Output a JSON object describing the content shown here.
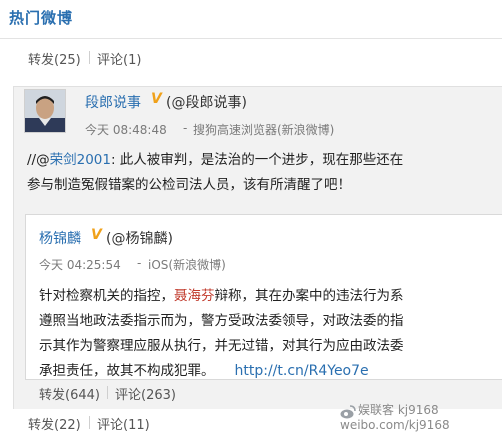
{
  "section": {
    "title": "热门微博"
  },
  "top_actions": {
    "repost": "转发(25)",
    "comment": "评论(1)"
  },
  "post": {
    "author": "段郎说事",
    "handle": "(@段郎说事)",
    "time": "今天 08:48:48",
    "source": "搜狗高速浏览器(新浪微博)",
    "content_prefix": "//@",
    "mention": "荣剑2001",
    "content_line1_rest": ": 此人被审判，是法治的一个进步，现在那些还在",
    "content_line2": "参与制造冤假错案的公检司法人员，该有所清醒了吧！"
  },
  "retweet": {
    "author": "杨锦麟",
    "handle": "(@杨锦麟)",
    "time": "今天 04:25:54",
    "source": "iOS(新浪微博)",
    "line1_pre": "针对检察机关的指控，",
    "line1_name": "聂海芬",
    "line1_post": "辩称，其在办案中的违法行为系",
    "line2": "遵照当地政法委指示而为，警方受政法委领导，对政法委的指",
    "line3": "示其作为警察理应服从执行，并无过错，对其行为应由政法委",
    "line4_text": "承担责任，故其不构成犯罪。",
    "line4_link": "http://t.cn/R4Yeo7e",
    "repost": "转发(644)",
    "comment": "评论(263)"
  },
  "bottom_actions": {
    "repost": "转发(22)",
    "comment": "评论(11)"
  },
  "watermark": {
    "line1": "娱联客 kj9168",
    "line2": "weibo.com/kj9168"
  },
  "colors": {
    "link": "#2a6fb0",
    "vip_badge": "#f0a11a",
    "highlight": "#c0392b"
  },
  "icons": {
    "verified": "v-badge-icon",
    "watermark": "weibo-logo-icon"
  }
}
